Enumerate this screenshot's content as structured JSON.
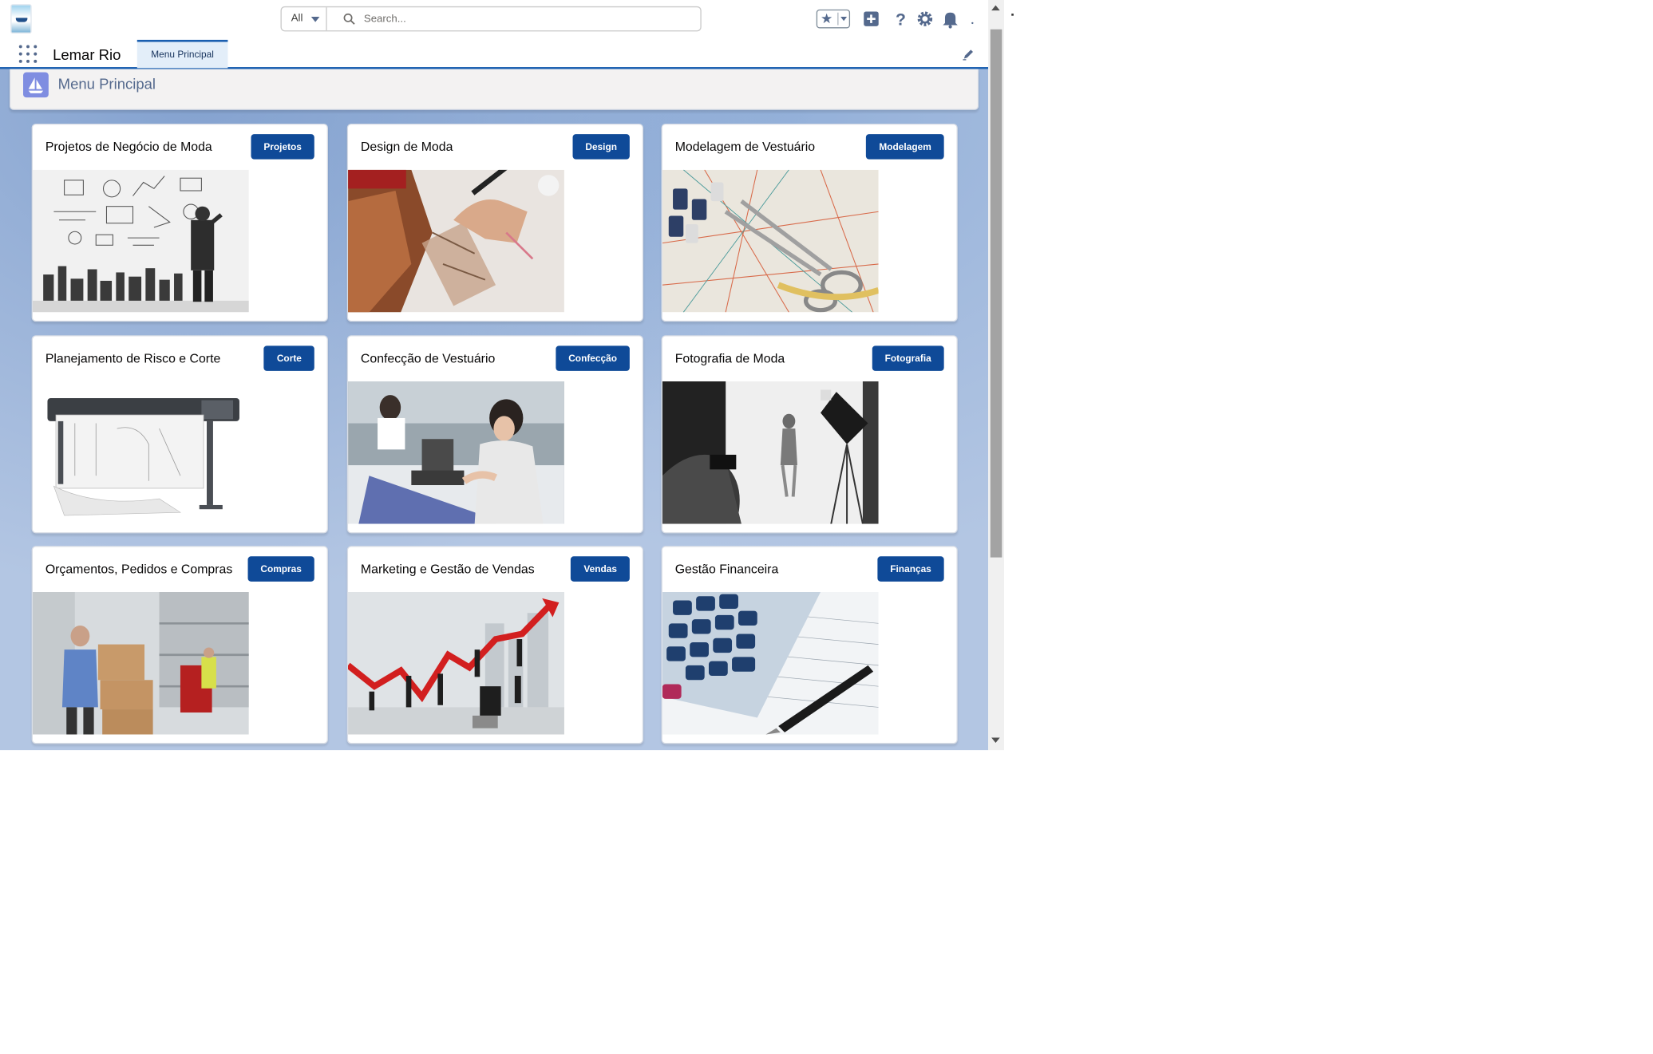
{
  "header": {
    "search_scope": "All",
    "search_placeholder": "Search..."
  },
  "app": {
    "name": "Lemar Rio",
    "tab_label": "Menu Principal"
  },
  "page": {
    "title": "Menu Principal"
  },
  "cards": [
    {
      "title": "Projetos de Negócio de Moda",
      "button": "Projetos",
      "image": "businessman-drawing-wall"
    },
    {
      "title": "Design de Moda",
      "button": "Design",
      "image": "hand-sketching-fashion"
    },
    {
      "title": "Modelagem de Vestuário",
      "button": "Modelagem",
      "image": "sewing-patterns-scissors"
    },
    {
      "title": "Planejamento de Risco e Corte",
      "button": "Corte",
      "image": "plotter-machine"
    },
    {
      "title": "Confecção de Vestuário",
      "button": "Confecção",
      "image": "seamstress-sewing"
    },
    {
      "title": "Fotografia de Moda",
      "button": "Fotografia",
      "image": "photo-studio"
    },
    {
      "title": "Orçamentos, Pedidos e Compras",
      "button": "Compras",
      "image": "warehouse-boxes"
    },
    {
      "title": "Marketing e Gestão de Vendas",
      "button": "Vendas",
      "image": "growth-arrow-people"
    },
    {
      "title": "Gestão Financeira",
      "button": "Finanças",
      "image": "calculator-pen"
    }
  ],
  "colors": {
    "brand_blue": "#0f4a98",
    "nav_accent": "#1b5fb0",
    "background": "#b3c6e3",
    "page_icon": "#7f8de1"
  }
}
